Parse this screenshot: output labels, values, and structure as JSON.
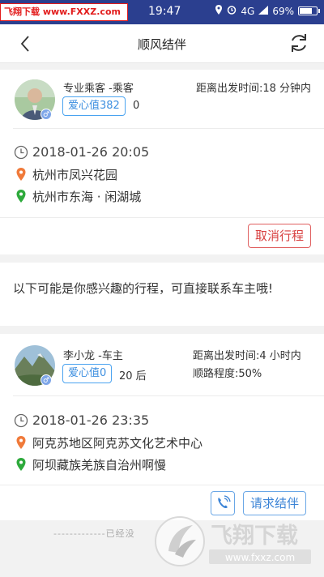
{
  "status_bar": {
    "watermark": "飞翔下载 www.FXXZ.com",
    "time": "19:47",
    "network": "4G",
    "battery": "69%",
    "battery_level": 0.69
  },
  "header": {
    "title": "顺风结伴"
  },
  "my_trip": {
    "role": "专业乘客 -乘客",
    "departure_info": "距离出发时间:18 分钟内",
    "love_badge": "爱心值382",
    "love_count": "0",
    "gender": "♂",
    "datetime": "2018-01-26 20:05",
    "origin": "杭州市凤兴花园",
    "destination": "杭州市东海 · 闲湖城",
    "cancel_button": "取消行程"
  },
  "suggestion_note": "以下可能是你感兴趣的行程，可直接联系车主哦!",
  "driver_trip": {
    "role": "李小龙 -车主",
    "departure_info": "距离出发时间:4 小时内",
    "route_match": "顺路程度:50%",
    "love_badge": "爱心值0",
    "love_count": "20 后",
    "gender": "♂",
    "datetime": "2018-01-26 23:35",
    "origin": "阿克苏地区阿克苏文化艺术中心",
    "destination": "阿坝藏族羌族自治州啊慢",
    "request_button": "请求结伴"
  },
  "footer_text": "-------------已经没",
  "watermark_logo": {
    "title": "飞翔下载",
    "url": "www.fxxz.com"
  },
  "colors": {
    "status_bar": "#2b3f8f",
    "accent_blue": "#3d8fe0",
    "accent_red": "#d84040",
    "origin_pin": "#f07a3a",
    "destination_pin": "#2eaa3c"
  }
}
